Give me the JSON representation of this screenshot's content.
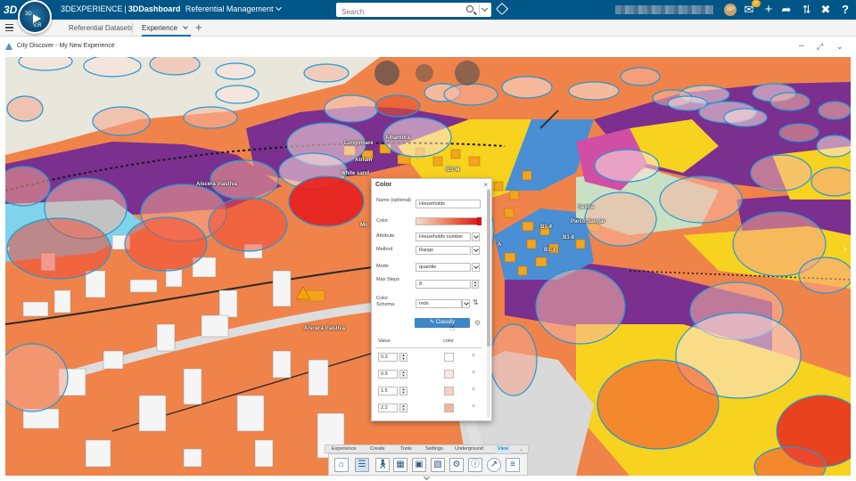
{
  "topbar": {
    "brand": "3D",
    "compass": {
      "top_label": "3D",
      "bottom_label": "V,R"
    },
    "title_prefix": "3DEXPERIENCE",
    "title_product": "3DDashboard",
    "title_app": "Referential Management",
    "search_placeholder": "Search",
    "avatar_initials": "SP",
    "notification_count": "37"
  },
  "tabs": {
    "items": [
      {
        "label": "Referential Datasets"
      },
      {
        "label": "Experience"
      }
    ],
    "active": "Experience"
  },
  "widget": {
    "title": "City Discover - My New Experience"
  },
  "map": {
    "labels": [
      "Lungomare",
      "Atrium",
      "White sand",
      "Alhambra",
      "Aiscera Viastiva",
      "Mo",
      "Aiscera Viastiva",
      "BS-M",
      "B1-4",
      "B1-1",
      "Sellira",
      "Parco Saugar",
      "B1-8",
      "A"
    ]
  },
  "color_panel": {
    "title": "Color",
    "name_label": "Name (optional)",
    "name_value": "Households",
    "color_label": "Color",
    "attribute_label": "Attribute",
    "attribute_value": "Households number",
    "method_label": "Method",
    "method_value": "Range",
    "mode_label": "Mode",
    "mode_value": "quantile",
    "max_steps_label": "Max Steps",
    "max_steps_value": "8",
    "color_schema_label": "Color Schema",
    "color_schema_value": "reds",
    "classify_label": "Classify",
    "table": {
      "col_value": "Value",
      "col_color": "color",
      "rows": [
        {
          "value": "0.3",
          "color": "#ffffff"
        },
        {
          "value": "0.9",
          "color": "#fde6df"
        },
        {
          "value": "1.5",
          "color": "#f9cfc2"
        },
        {
          "value": "2.2",
          "color": "#f5b3a0"
        }
      ]
    }
  },
  "bottom_toolbar": {
    "tabs": [
      "Experience",
      "Create",
      "Tools",
      "Settings",
      "Underground",
      "View"
    ],
    "active_tab": "View",
    "icons": [
      "home-icon",
      "layers-panel-icon",
      "person-walk-icon",
      "grid-list-icon",
      "image-view-icon",
      "photo-settings-icon",
      "gear-icon",
      "info-panel-icon",
      "compass-needle-icon",
      "legend-list-icon"
    ]
  },
  "colors": {
    "app_bar": "#005686",
    "accent": "#3f86c4",
    "parcel_orange": "#f0834a",
    "parcel_purple": "#7b2f8e",
    "parcel_yellow": "#f7d21f",
    "parcel_blue": "#4a8fd4"
  }
}
